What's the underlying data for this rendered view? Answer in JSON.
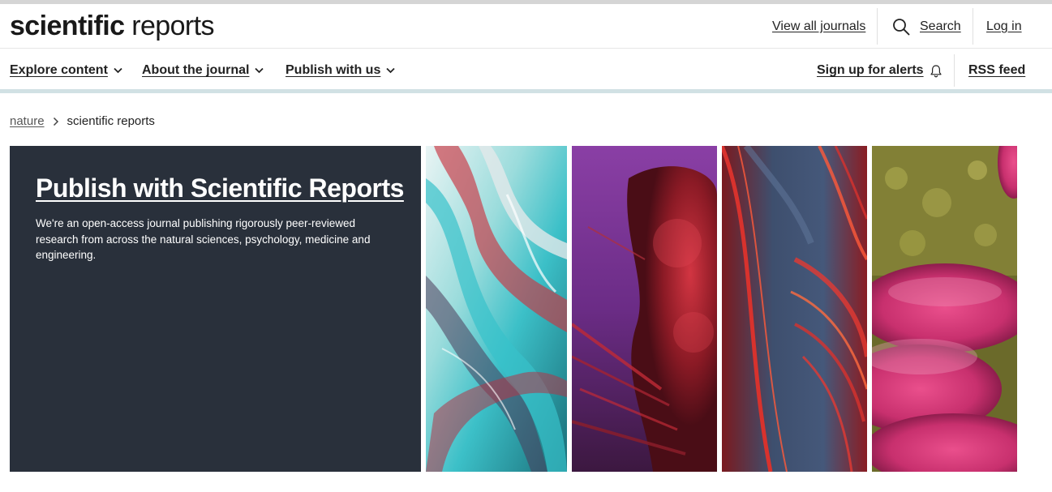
{
  "header": {
    "logo_bold": "scientific",
    "logo_light": "reports",
    "view_all_journals": "View all journals",
    "search_label": "Search",
    "login_label": "Log in"
  },
  "nav": {
    "explore_content": "Explore content",
    "about_journal": "About the journal",
    "publish_with_us": "Publish with us",
    "sign_up_alerts": "Sign up for alerts",
    "rss_feed": "RSS feed"
  },
  "breadcrumb": {
    "parent": "nature",
    "current": "scientific reports"
  },
  "hero": {
    "title": "Publish with Scientific Reports",
    "description": "We're an open-access journal publishing rigorously peer-reviewed research from across the natural sciences, psychology, medicine and engineering."
  },
  "colors": {
    "hero_background": "#29303b",
    "nav_border": "#d1e1e4",
    "text": "#222222"
  },
  "icons": [
    "search-icon",
    "chevron-down-icon",
    "bell-icon",
    "chevron-right-icon"
  ]
}
